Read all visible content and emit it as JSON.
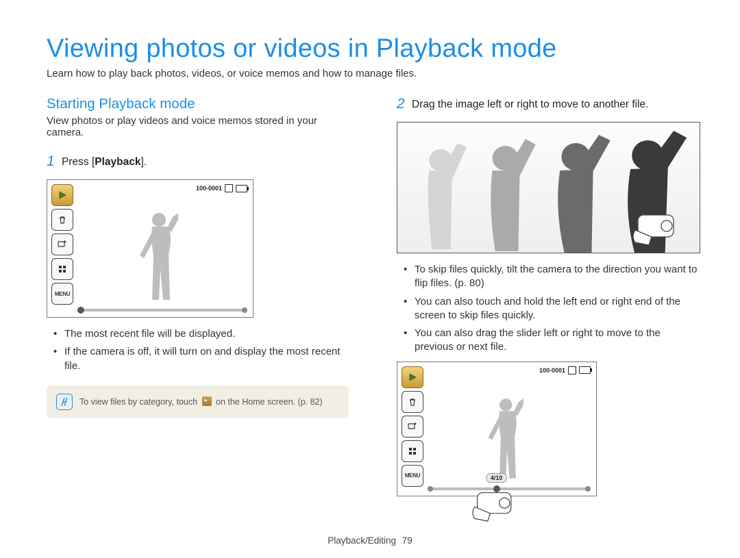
{
  "title": "Viewing photos or videos in Playback mode",
  "subtitle": "Learn how to play back photos, videos, or voice memos and how to manage files.",
  "left": {
    "section_title": "Starting Playback mode",
    "section_sub": "View photos or play videos and voice memos stored in your camera.",
    "step1_num": "1",
    "step1_prefix": "Press [",
    "step1_bold": "Playback",
    "step1_suffix": "].",
    "screen": {
      "file_counter": "100-0001",
      "menu_label": "MENU"
    },
    "bullets": [
      "The most recent file will be displayed.",
      "If the camera is off, it will turn on and display the most recent file."
    ],
    "note_prefix": "To view files by category, touch ",
    "note_suffix": " on the Home screen. (p. 82)"
  },
  "right": {
    "step2_num": "2",
    "step2_text": "Drag the image left or right to move to another file.",
    "bullets": [
      "To skip files quickly, tilt the camera to the direction you want to flip files. (p. 80)",
      "You can also touch and hold the left end or right end of the screen to skip files quickly.",
      "You can also drag the slider left or right to move to the previous or next file."
    ],
    "screen": {
      "file_counter": "100-0001",
      "menu_label": "MENU",
      "slider_counter": "4/10"
    }
  },
  "footer": {
    "section": "Playback/Editing",
    "page": "79"
  }
}
